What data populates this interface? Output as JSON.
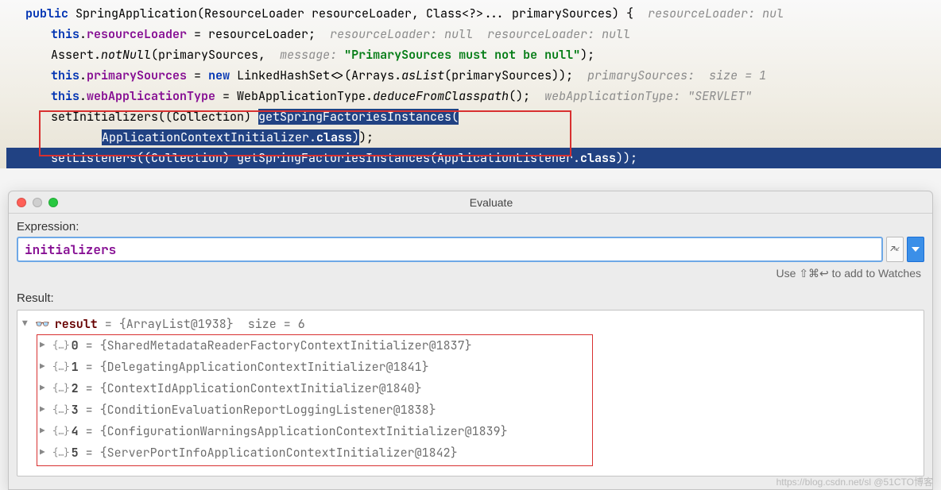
{
  "code": {
    "line1": {
      "keyword": "public",
      "ctor": "SpringApplication",
      "params": "(ResourceLoader resourceLoader, Class<?>... primarySources) {",
      "hint": "resourceLoader: nul"
    },
    "line2": {
      "this": "this",
      "field": "resourceLoader",
      "rest": " = resourceLoader;",
      "hint1": "resourceLoader: null",
      "hint2": "resourceLoader: null"
    },
    "line3": {
      "cls": "Assert",
      "method": "notNull",
      "args_open": "(primarySources, ",
      "msg_label": "message:",
      "str": "\"PrimarySources must not be null\"",
      "close": ");"
    },
    "line4": {
      "this": "this",
      "field": "primarySources",
      "assign": " = ",
      "new": "new",
      "type": " LinkedHashSet<>(Arrays.",
      "asList": "asList",
      "rest": "(primarySources));",
      "hint1": "primarySources:",
      "hint2": "size = 1"
    },
    "line5": {
      "this": "this",
      "field": "webApplicationType",
      "assign": " = WebApplicationType.",
      "method": "deduceFromClasspath",
      "close": "();",
      "hint": "webApplicationType: \"SERVLET\""
    },
    "line6": {
      "pre": "setInitializers((Collection) ",
      "sel1": "getSpringFactoriesInstances("
    },
    "line7": {
      "sel2_a": "ApplicationContextInitializer.",
      "sel2_b": "class",
      "sel2_c": ")",
      "after": ");"
    },
    "line8": {
      "text_a": "setListeners((Collection) getSpringFactoriesInstances(ApplicationListener.",
      "text_b": "class",
      "text_c": "));"
    }
  },
  "evaluate": {
    "title": "Evaluate",
    "expression_label": "Expression:",
    "expression_value": "initializers",
    "hint": "Use ⇧⌘↩ to add to Watches",
    "result_label": "Result:",
    "root": {
      "name": "result",
      "value": " = {ArrayList@1938}  size = 6"
    },
    "items": [
      {
        "idx": "0",
        "val": " = {SharedMetadataReaderFactoryContextInitializer@1837} "
      },
      {
        "idx": "1",
        "val": " = {DelegatingApplicationContextInitializer@1841} "
      },
      {
        "idx": "2",
        "val": " = {ContextIdApplicationContextInitializer@1840} "
      },
      {
        "idx": "3",
        "val": " = {ConditionEvaluationReportLoggingListener@1838} "
      },
      {
        "idx": "4",
        "val": " = {ConfigurationWarningsApplicationContextInitializer@1839} "
      },
      {
        "idx": "5",
        "val": " = {ServerPortInfoApplicationContextInitializer@1842} "
      }
    ]
  },
  "watermark": "https://blog.csdn.net/sl @51CTO博客"
}
